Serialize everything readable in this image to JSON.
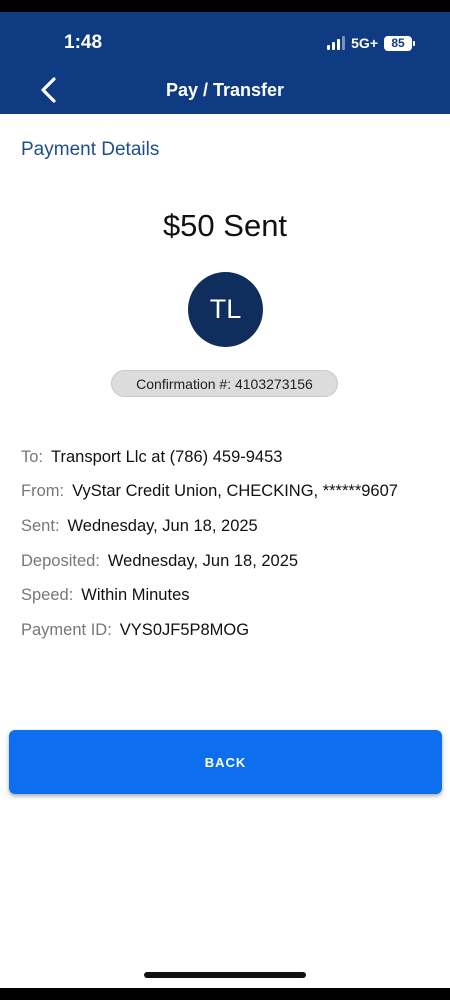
{
  "status_bar": {
    "time": "1:48",
    "network": "5G+",
    "battery": "85"
  },
  "header": {
    "title": "Pay / Transfer",
    "back_icon": "chevron-left-icon"
  },
  "section_title": "Payment Details",
  "amount_text": "$50 Sent",
  "recipient_initials": "TL",
  "confirmation": "Confirmation #: 4103273156",
  "details": [
    {
      "label": "To:",
      "value": "Transport Llc at (786) 459-9453"
    },
    {
      "label": "From:",
      "value": "VyStar Credit Union, CHECKING, ******9607"
    },
    {
      "label": "Sent:",
      "value": "Wednesday, Jun 18, 2025"
    },
    {
      "label": "Deposited:",
      "value": "Wednesday, Jun 18, 2025"
    },
    {
      "label": "Speed:",
      "value": "Within Minutes"
    },
    {
      "label": "Payment ID:",
      "value": "VYS0JF5P8MOG"
    }
  ],
  "back_button_label": "BACK",
  "colors": {
    "header_bg": "#0f3b82",
    "avatar_bg": "#0f2e5e",
    "button_bg": "#0d6ff0",
    "section_title": "#1f4f8a"
  }
}
